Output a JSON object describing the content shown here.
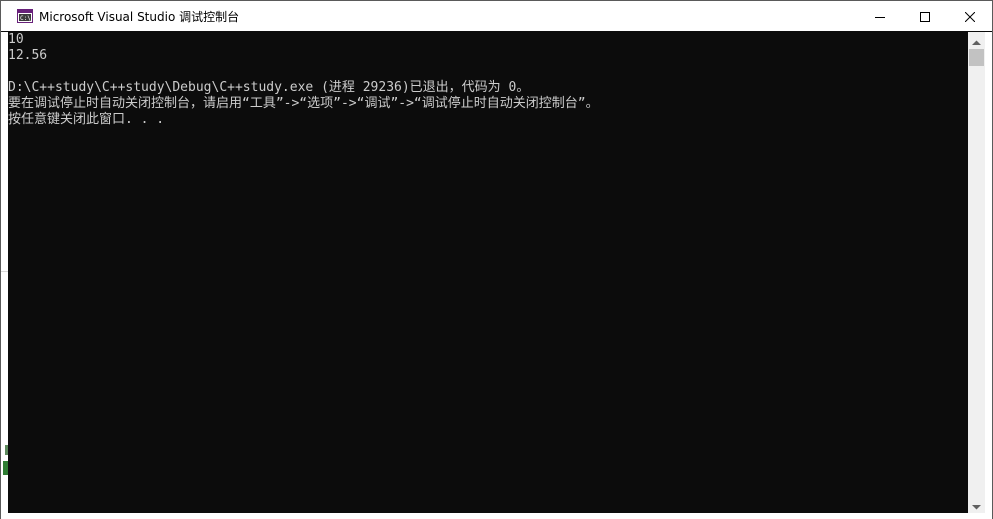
{
  "window": {
    "title": "Microsoft Visual Studio 调试控制台",
    "icon": "visual-studio-console-icon",
    "controls": {
      "minimize_icon": "minimize-icon",
      "maximize_icon": "maximize-icon",
      "close_icon": "close-icon"
    }
  },
  "console": {
    "lines": [
      "10",
      "12.56",
      "",
      "D:\\C++study\\C++study\\Debug\\C++study.exe (进程 29236)已退出，代码为 0。",
      "要在调试停止时自动关闭控制台，请启用“工具”->“选项”->“调试”->“调试停止时自动关闭控制台”。",
      "按任意键关闭此窗口. . ."
    ],
    "text_color": "#cccccc",
    "background_color": "#0c0c0c"
  },
  "scrollbar": {
    "up_icon": "scroll-up-arrow-icon",
    "down_icon": "scroll-down-arrow-icon"
  }
}
